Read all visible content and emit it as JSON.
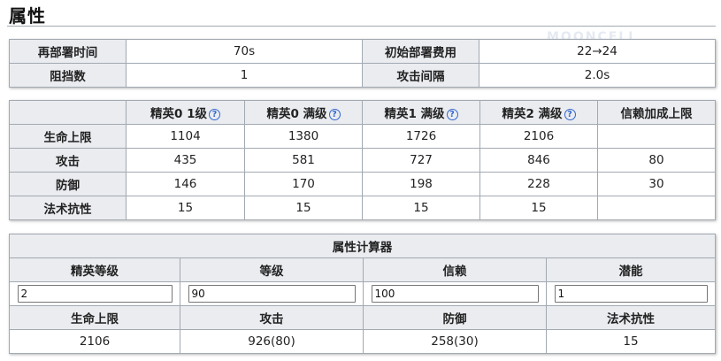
{
  "section_title": "属性",
  "basic": {
    "rows": [
      [
        "再部署时间",
        "70s",
        "初始部署费用",
        "22→24"
      ],
      [
        "阻挡数",
        "1",
        "攻击间隔",
        "2.0s"
      ]
    ]
  },
  "stats": {
    "headers": [
      "",
      "精英0 1级",
      "精英0 满级",
      "精英1 满级",
      "精英2 满级",
      "信赖加成上限"
    ],
    "help_glyph": "?",
    "rows": [
      [
        "生命上限",
        "1104",
        "1380",
        "1726",
        "2106",
        ""
      ],
      [
        "攻击",
        "435",
        "581",
        "727",
        "846",
        "80"
      ],
      [
        "防御",
        "146",
        "170",
        "198",
        "228",
        "30"
      ],
      [
        "法术抗性",
        "15",
        "15",
        "15",
        "15",
        ""
      ]
    ]
  },
  "calculator": {
    "title": "属性计算器",
    "input_labels": [
      "精英等级",
      "等级",
      "信赖",
      "潜能"
    ],
    "input_values": [
      "2",
      "90",
      "100",
      "1"
    ],
    "output_labels": [
      "生命上限",
      "攻击",
      "防御",
      "法术抗性"
    ],
    "output_values": [
      "2106",
      "926(80)",
      "258(30)",
      "15"
    ]
  },
  "watermark_text": "MOONCELL"
}
